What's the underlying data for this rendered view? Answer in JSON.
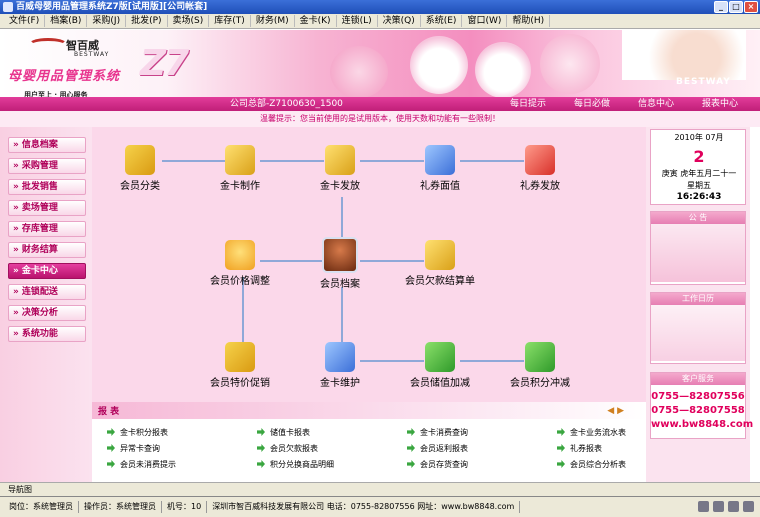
{
  "window": {
    "title": "百威母婴用品管理系统Z7版[试用版][公司帐套]"
  },
  "menu": [
    "文件(F)",
    "档案(B)",
    "采购(J)",
    "批发(P)",
    "卖场(S)",
    "库存(T)",
    "财务(M)",
    "金卡(K)",
    "连锁(L)",
    "决策(Q)",
    "系统(E)",
    "窗口(W)",
    "帮助(H)"
  ],
  "banner": {
    "logo_cn": "智百威",
    "logo_en": "BESTWAY",
    "app_name": "母婴用品管理系统",
    "version_mark": "Z7",
    "slogan": "用户至上 · 用心服务",
    "bestway": "BESTWAY"
  },
  "navbar": {
    "company": "公司总部-Z7100630_1500",
    "links": [
      "每日提示",
      "每日必做",
      "信息中心",
      "报表中心"
    ]
  },
  "notice": "温馨提示：您当前使用的是试用版本，使用天数和功能有一些限制！",
  "sidebar": {
    "items": [
      {
        "label": "信息档案",
        "active": false
      },
      {
        "label": "采购管理",
        "active": false
      },
      {
        "label": "批发销售",
        "active": false
      },
      {
        "label": "卖场管理",
        "active": false
      },
      {
        "label": "存库管理",
        "active": false
      },
      {
        "label": "财务结算",
        "active": false
      },
      {
        "label": "金卡中心",
        "active": true
      },
      {
        "label": "连锁配送",
        "active": false
      },
      {
        "label": "决策分析",
        "active": false
      },
      {
        "label": "系统功能",
        "active": false
      }
    ]
  },
  "flow": {
    "nodes": [
      {
        "label": "会员分类",
        "icon": "member-category-icon"
      },
      {
        "label": "金卡制作",
        "icon": "card-make-icon"
      },
      {
        "label": "金卡发放",
        "icon": "card-issue-icon"
      },
      {
        "label": "礼券面值",
        "icon": "coupon-value-icon"
      },
      {
        "label": "礼券发放",
        "icon": "coupon-issue-icon"
      },
      {
        "label": "会员价格调整",
        "icon": "price-adjust-icon"
      },
      {
        "label": "会员档案",
        "icon": "member-profile-icon"
      },
      {
        "label": "会员欠款结算单",
        "icon": "debt-settle-icon"
      },
      {
        "label": "会员特价促销",
        "icon": "special-promo-icon"
      },
      {
        "label": "金卡维护",
        "icon": "card-maintain-icon"
      },
      {
        "label": "会员储值加减",
        "icon": "stored-value-icon"
      },
      {
        "label": "会员积分冲减",
        "icon": "points-offset-icon"
      }
    ]
  },
  "reports": {
    "title": "报 表",
    "items": [
      "金卡积分报表",
      "储值卡报表",
      "金卡消费查询",
      "金卡业务流水表",
      "异常卡查询",
      "会员欠款报表",
      "会员返利报表",
      "礼券报表",
      "会员未消费提示",
      "积分兑换商品明细",
      "会员存货查询",
      "会员综合分析表"
    ]
  },
  "calendar": {
    "year_month": "2010年 07月",
    "day": "2",
    "lunar": "庚寅 虎年五月二十一",
    "weekday": "星期五",
    "time": "16:26:43"
  },
  "panels": {
    "notice_title": "公 告",
    "calendar_title": "工作日历",
    "service_title": "客户服务",
    "phone1": "0755—82807556",
    "phone2": "0755—82807558",
    "website": "www.bw8848.com"
  },
  "nav_tab": "导航图",
  "statusbar": {
    "post": "岗位：系统管理员",
    "operator": "操作员：系统管理员",
    "machine": "机号：10",
    "company": "深圳市智百威科技发展有限公司 电话：0755-82807556 网址：www.bw8848.com"
  },
  "colors": {
    "accent": "#e23c9a",
    "sidebar_text": "#b0005a",
    "service_text": "#e0005c"
  }
}
